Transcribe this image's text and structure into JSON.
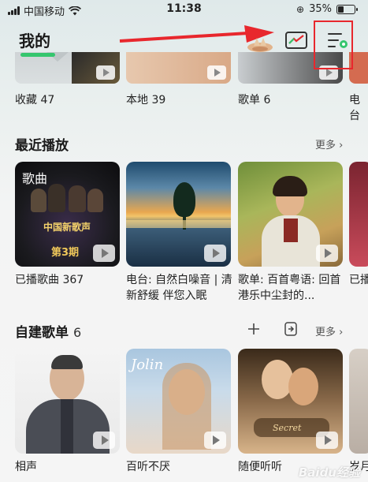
{
  "status_bar": {
    "carrier": "中国移动",
    "time": "11:38",
    "battery_text": "35%",
    "battery_level": 0.35
  },
  "header": {
    "title": "我的"
  },
  "top_row": [
    {
      "label": "收藏 47"
    },
    {
      "label": "本地 39"
    },
    {
      "label": "歌单 6"
    },
    {
      "label": "电台"
    }
  ],
  "recent": {
    "title": "最近播放",
    "more": "更多",
    "cards": [
      {
        "label": "已播歌曲 367",
        "cover_text_1": "歌曲",
        "cover_text_2": "中国新歌声",
        "cover_text_3": "第3期"
      },
      {
        "label": "电台: 自然白噪音 | 清新舒缓 伴您入眠"
      },
      {
        "label": "歌单: 百首粤语: 回首港乐中尘封的..."
      },
      {
        "label": "已播"
      }
    ]
  },
  "my_playlists": {
    "title": "自建歌单",
    "count": "6",
    "more": "更多",
    "cards": [
      {
        "label": "相声"
      },
      {
        "label": "百听不厌"
      },
      {
        "label": "随便听听"
      },
      {
        "label": "岁月"
      }
    ]
  },
  "watermark": "Baidu经验",
  "colors": {
    "accent_green": "#35c66e",
    "annotation_red": "#e8272d"
  },
  "icons": {
    "wifi": "wifi-icon",
    "orientation_lock": "orientation-lock-icon",
    "screen_cast": "screen-cast-icon",
    "menu": "menu-settings-icon",
    "add": "plus-icon",
    "import": "import-icon",
    "chevron": "chevron-right-icon"
  }
}
